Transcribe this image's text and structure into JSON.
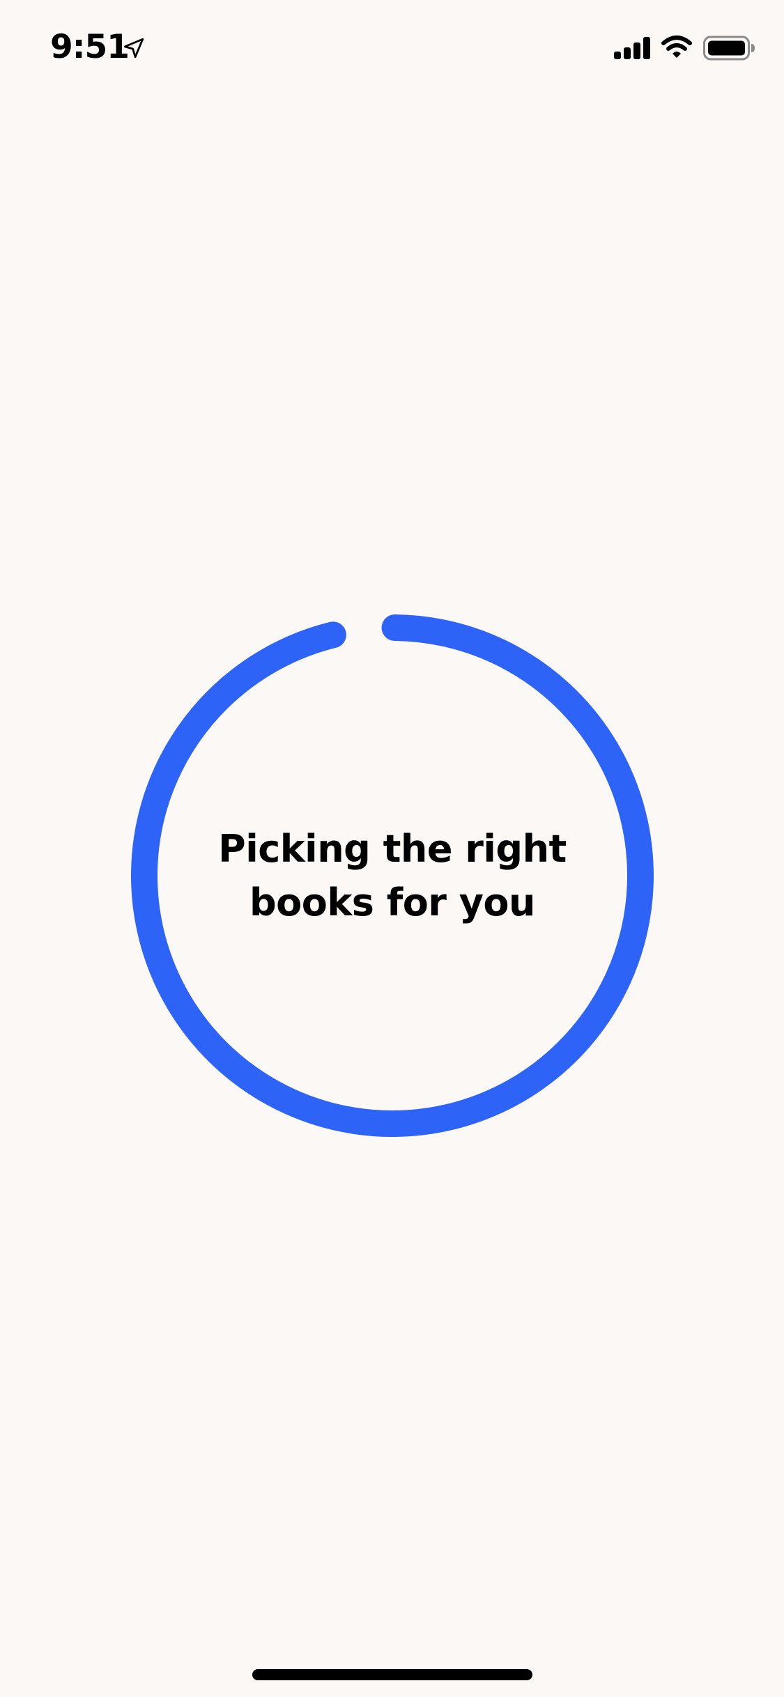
{
  "status_bar": {
    "time": "9:51",
    "icons": [
      "location-arrow-icon",
      "cellular-signal-icon",
      "wifi-icon",
      "battery-icon"
    ],
    "battery_level": 1.0
  },
  "loader": {
    "text": "Picking the right books for you",
    "progress": 0.96,
    "color": "#2D63F6"
  },
  "colors": {
    "background": "#FCF8F5",
    "accent": "#2D63F6",
    "text": "#000000"
  }
}
